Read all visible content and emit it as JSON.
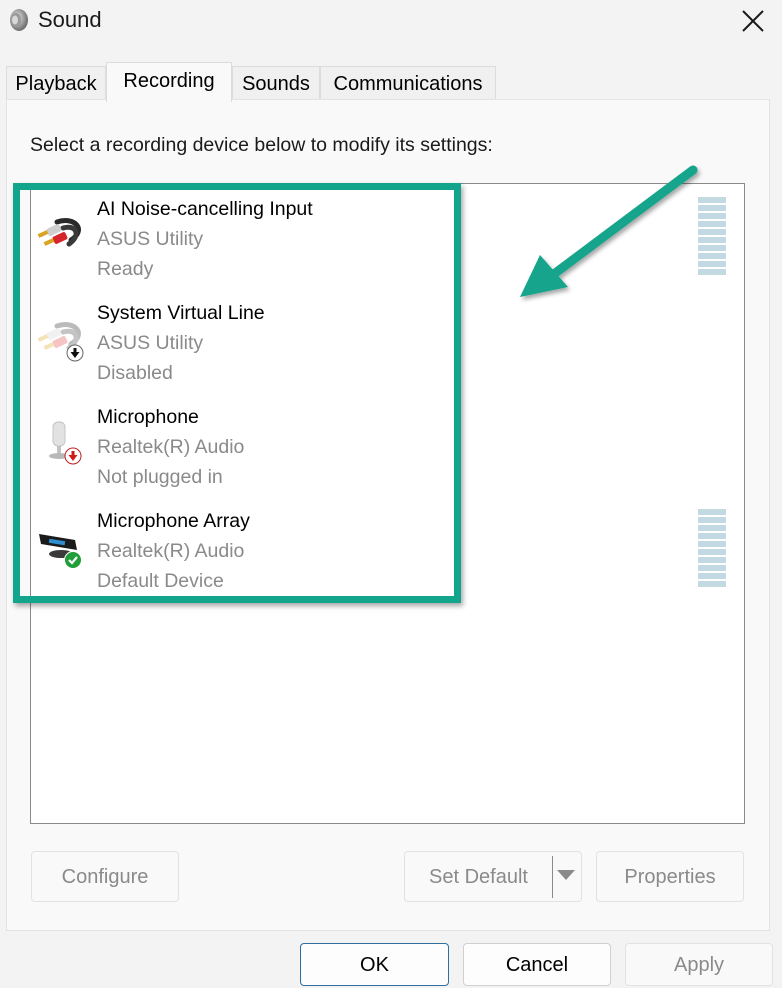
{
  "window": {
    "title": "Sound",
    "app_icon": "speaker-icon",
    "close_icon": "close-icon"
  },
  "tabs": [
    {
      "label": "Playback",
      "active": false
    },
    {
      "label": "Recording",
      "active": true
    },
    {
      "label": "Sounds",
      "active": false
    },
    {
      "label": "Communications",
      "active": false
    }
  ],
  "instruction": "Select a recording device below to modify its settings:",
  "devices": [
    {
      "name": "AI Noise-cancelling Input",
      "driver": "ASUS Utility",
      "status": "Ready",
      "icon": "rca-cable-icon",
      "badge": "none",
      "level_meter": true
    },
    {
      "name": "System Virtual Line",
      "driver": "ASUS Utility",
      "status": "Disabled",
      "icon": "rca-cable-icon",
      "badge": "disabled-down-arrow-icon",
      "level_meter": false
    },
    {
      "name": "Microphone",
      "driver": "Realtek(R) Audio",
      "status": "Not plugged in",
      "icon": "microphone-icon",
      "badge": "unplugged-red-arrow-icon",
      "level_meter": false
    },
    {
      "name": "Microphone Array",
      "driver": "Realtek(R) Audio",
      "status": "Default Device",
      "icon": "microphone-array-icon",
      "badge": "default-green-check-icon",
      "level_meter": true
    }
  ],
  "buttons": {
    "configure": "Configure",
    "set_default": "Set Default",
    "properties": "Properties",
    "ok": "OK",
    "cancel": "Cancel",
    "apply": "Apply"
  },
  "annotation": {
    "highlight_color": "#13a58c",
    "arrow_color": "#13a58c"
  },
  "colors": {
    "meter": "#c3dae3",
    "disabled_text": "#8a8a8a"
  }
}
